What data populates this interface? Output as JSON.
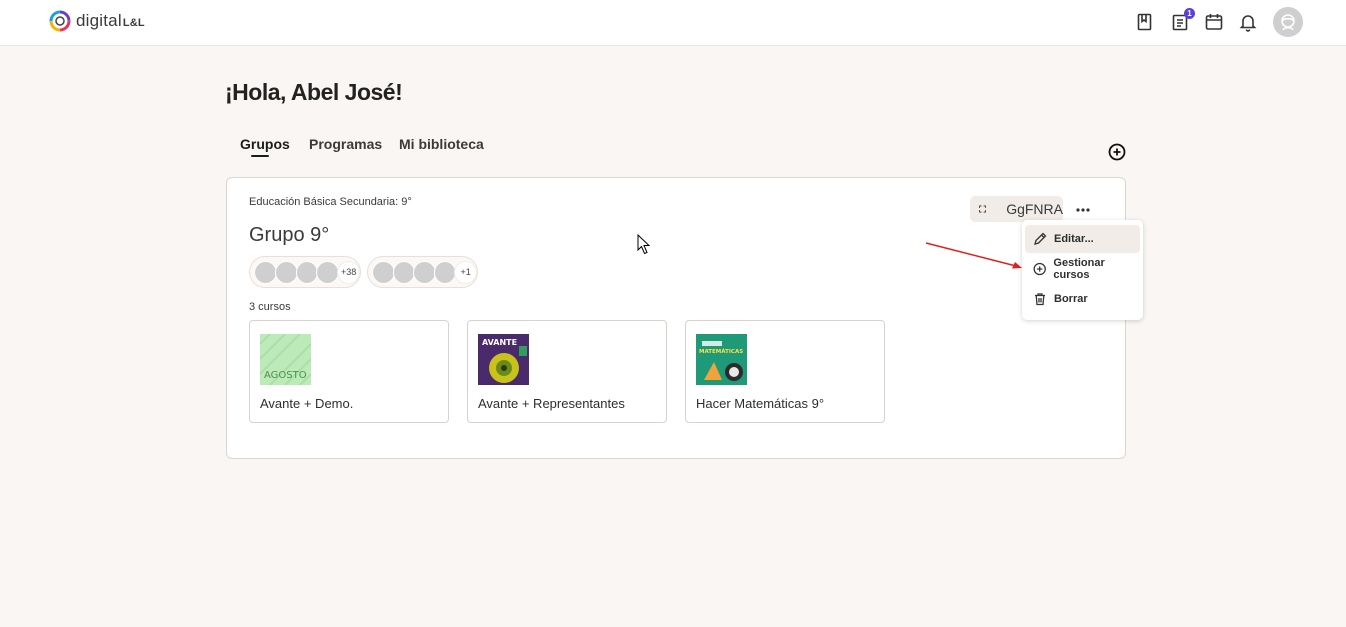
{
  "header": {
    "brand": "digital",
    "brand_suffix": "L&L",
    "icons": [
      "book-icon",
      "clipboard-icon",
      "calendar-icon",
      "bell-icon"
    ],
    "notification_count": "1"
  },
  "greeting": "¡Hola, Abel José!",
  "tabs": [
    {
      "label": "Grupos",
      "active": true
    },
    {
      "label": "Programas",
      "active": false
    },
    {
      "label": "Mi biblioteca",
      "active": false
    }
  ],
  "group": {
    "level": "Educación Básica Secundaria: 9°",
    "title": "Grupo 9°",
    "students_extra": "+38",
    "teachers_extra": "+1",
    "code": "GgFNRA",
    "courses_count": "3 cursos",
    "courses": [
      {
        "name": "Avante + Demo.",
        "thumb_text": "AGOSTO"
      },
      {
        "name": "Avante + Representantes",
        "thumb_text": "AVANTE"
      },
      {
        "name": "Hacer Matemáticas 9°",
        "thumb_text": "MATEMÁTICAS"
      }
    ]
  },
  "menu": {
    "items": [
      {
        "label": "Editar...",
        "icon": "pencil-icon"
      },
      {
        "label": "Gestionar cursos",
        "icon": "plus-circle-icon"
      },
      {
        "label": "Borrar",
        "icon": "trash-icon"
      }
    ]
  },
  "colors": {
    "background": "#f9f6f3",
    "badge": "#5b3fd6",
    "annotation_arrow": "#e02020"
  }
}
